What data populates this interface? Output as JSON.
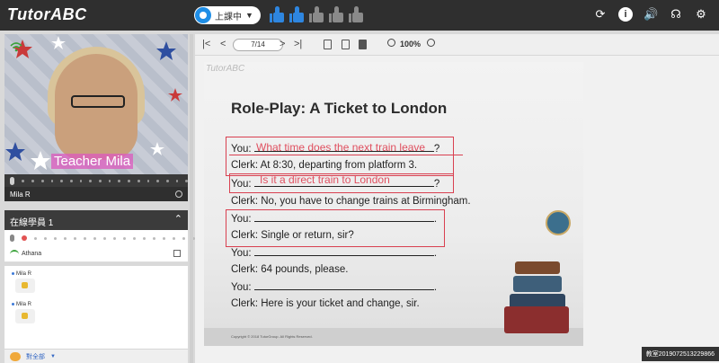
{
  "app": {
    "logo": "TutorABC"
  },
  "status": {
    "label": "上課中"
  },
  "rating": {
    "filled": 2,
    "total": 5
  },
  "top_icons": [
    "refresh-icon",
    "info-icon",
    "volume-icon",
    "support-icon",
    "settings-icon"
  ],
  "video": {
    "caption": "Teacher Mila",
    "teacher_name": "Mila R"
  },
  "online": {
    "header": "在線學員 1",
    "student_name": "Athana"
  },
  "chat": {
    "messages": [
      {
        "sender": "Mila R"
      },
      {
        "sender": "Mila R"
      }
    ],
    "target": "對全部"
  },
  "viewer": {
    "page_indicator": "7/14",
    "zoom": "100%"
  },
  "slide": {
    "watermark": "TutorABC",
    "title": "Role-Play: A Ticket to London",
    "lines": [
      {
        "speaker": "You:",
        "suffix": "?"
      },
      {
        "text": "Clerk: At 8:30, departing from platform 3."
      },
      {
        "speaker": "You:",
        "suffix": "?"
      },
      {
        "text": "Clerk: No, you have to change trains at Birmingham."
      },
      {
        "speaker": "You:",
        "suffix": "."
      },
      {
        "text": "Clerk: Single or return, sir?"
      },
      {
        "speaker": "You:",
        "suffix": "."
      },
      {
        "text": "Clerk: 64 pounds, please."
      },
      {
        "speaker": "You:",
        "suffix": "."
      },
      {
        "text": "Clerk: Here is your ticket and change, sir."
      }
    ],
    "handwriting": [
      "What time does the next train leave",
      "Is it a direct train to London"
    ],
    "copyright": "Copyright © 2018 TutorGroup. All Rights Reserved."
  },
  "classroom_badge": "教室2019072513229866",
  "colors": {
    "accent": "#2e86e0",
    "annotation": "#d94050",
    "topbar": "#2f2f2f"
  }
}
